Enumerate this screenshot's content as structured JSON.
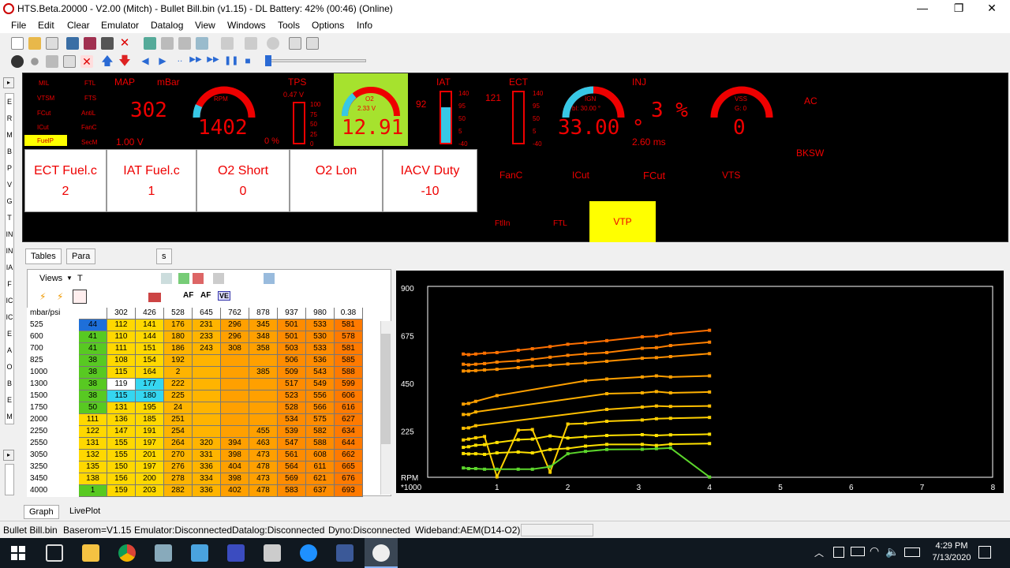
{
  "title": "HTS.Beta.20000 - V2.00 (Mitch)  - Bullet Bill.bin (v1.15) - DL  Battery: 42% (00:46) (Online)",
  "window_buttons": {
    "minimize": "—",
    "maximize": "❐",
    "close": "✕"
  },
  "menu": [
    "File",
    "Edit",
    "Clear",
    "Emulator",
    "Datalog",
    "View",
    "Windows",
    "Tools",
    "Options",
    "Info"
  ],
  "indicators_left": [
    "MIL",
    "VTSM",
    "FCut",
    "ICut",
    "FuelP"
  ],
  "indicators_mid": [
    "FTL",
    "FTS",
    "AntiL",
    "FanC",
    "SecM"
  ],
  "map": {
    "label": "MAP",
    "unit": "mBar",
    "value": "302",
    "volts": "1.00 V"
  },
  "rpm": {
    "label": "RPM",
    "value": "1402"
  },
  "tps": {
    "label": "TPS",
    "volts": "0.47 V",
    "value": "0 %",
    "scale": [
      "100",
      "75",
      "50",
      "25",
      "0"
    ]
  },
  "o2": {
    "label": "O2",
    "volts": "2.33 V",
    "value": "12.91"
  },
  "iat": {
    "label": "IAT",
    "value": "92",
    "scale": [
      "140",
      "95",
      "50",
      "5",
      "-40"
    ]
  },
  "ect": {
    "label": "ECT",
    "value": "121",
    "scale": [
      "140",
      "95",
      "50",
      "5",
      "-40"
    ]
  },
  "ign": {
    "label": "IGN",
    "sub": "bl: 30.00 °",
    "value": "33.00 °"
  },
  "inj": {
    "label": "INJ",
    "value": "3 %",
    "ms": "2.60 ms"
  },
  "vss": {
    "label": "VSS",
    "sub": "G: 0",
    "value": "0"
  },
  "flags_right": {
    "ac": "AC",
    "bksw": "BKSW",
    "fanc": "FanC",
    "icut": "ICut",
    "fcut": "FCut",
    "vts": "VTS",
    "ftlin": "FtlIn",
    "ftl": "FTL",
    "vtp": "VTP"
  },
  "cards": [
    {
      "name": "ECT Fuel.c",
      "value": "2"
    },
    {
      "name": "IAT Fuel.c",
      "value": "1"
    },
    {
      "name": "O2 Short",
      "value": "0"
    },
    {
      "name": "O2 Lon",
      "value": ""
    },
    {
      "name": "IACV Duty",
      "value": "-10"
    }
  ],
  "left_strip_letters": [
    "E",
    "R",
    "M",
    "B",
    "P",
    "V",
    "G",
    "T",
    "IN",
    "IN",
    "IA",
    "F",
    "IC",
    "IC",
    "E",
    "A",
    "O",
    "B",
    "E",
    "M"
  ],
  "tabs": {
    "tables": "Tables",
    "params": "Para",
    "other": "s"
  },
  "table_toolbar": {
    "views": "Views",
    "t": "T"
  },
  "grid": {
    "corner": "mbar/psi",
    "cols": [
      "",
      "302",
      "426",
      "528",
      "645",
      "762",
      "878",
      "937",
      "980",
      "0.38"
    ],
    "rows": [
      {
        "r": "525",
        "v": [
          "44",
          "112",
          "141",
          "176",
          "231",
          "296",
          "345",
          "501",
          "533",
          "581"
        ]
      },
      {
        "r": "600",
        "v": [
          "41",
          "110",
          "144",
          "180",
          "233",
          "296",
          "348",
          "501",
          "530",
          "578"
        ]
      },
      {
        "r": "700",
        "v": [
          "41",
          "111",
          "151",
          "186",
          "243",
          "308",
          "358",
          "503",
          "533",
          "581"
        ]
      },
      {
        "r": "825",
        "v": [
          "38",
          "108",
          "154",
          "192",
          "",
          "",
          "",
          "506",
          "536",
          "585"
        ]
      },
      {
        "r": "1000",
        "v": [
          "38",
          "115",
          "164",
          "2",
          "",
          "",
          "385",
          "509",
          "543",
          "588"
        ]
      },
      {
        "r": "1300",
        "v": [
          "38",
          "119",
          "177",
          "222",
          "",
          "",
          "",
          "517",
          "549",
          "599"
        ]
      },
      {
        "r": "1500",
        "v": [
          "38",
          "115",
          "180",
          "225",
          "",
          "",
          "",
          "523",
          "556",
          "606"
        ]
      },
      {
        "r": "1750",
        "v": [
          "50",
          "131",
          "195",
          "24",
          "",
          "",
          "",
          "528",
          "566",
          "616"
        ]
      },
      {
        "r": "2000",
        "v": [
          "111",
          "136",
          "185",
          "251",
          "",
          "",
          "",
          "534",
          "575",
          "627"
        ]
      },
      {
        "r": "2250",
        "v": [
          "122",
          "147",
          "191",
          "254",
          "",
          "",
          "455",
          "539",
          "582",
          "634"
        ]
      },
      {
        "r": "2550",
        "v": [
          "131",
          "155",
          "197",
          "264",
          "320",
          "394",
          "463",
          "547",
          "588",
          "644"
        ]
      },
      {
        "r": "3050",
        "v": [
          "132",
          "155",
          "201",
          "270",
          "331",
          "398",
          "473",
          "561",
          "608",
          "662"
        ]
      },
      {
        "r": "3250",
        "v": [
          "135",
          "150",
          "197",
          "276",
          "336",
          "404",
          "478",
          "564",
          "611",
          "665"
        ]
      },
      {
        "r": "3450",
        "v": [
          "138",
          "156",
          "200",
          "278",
          "334",
          "398",
          "473",
          "569",
          "621",
          "676"
        ]
      },
      {
        "r": "4000",
        "v": [
          "1",
          "159",
          "203",
          "282",
          "336",
          "402",
          "478",
          "583",
          "637",
          "693"
        ]
      }
    ]
  },
  "graph": {
    "y_ticks": [
      "900",
      "675",
      "450",
      "225"
    ],
    "x_ticks": [
      "1",
      "2",
      "3",
      "4",
      "5",
      "6",
      "7",
      "8"
    ],
    "y_unit": "RPM",
    "x_unit": "*1000"
  },
  "bottom_tabs": [
    "Graph",
    "LivePlot"
  ],
  "status": [
    "Bullet Bill.bin",
    "Baserom=V1.15",
    "Emulator:Disconnected",
    "Datalog:Disconnected",
    "Dyno:Disconnected",
    "Wideband:AEM(D14-O2)"
  ],
  "clock": {
    "time": "4:29 PM",
    "date": "7/13/2020"
  },
  "colors": {
    "dash_bg": "#000000",
    "gauge_red": "#e00000",
    "o2_bg": "#a6e22e",
    "vtp_bg": "#ffff00",
    "cyan": "#37c8e6"
  }
}
